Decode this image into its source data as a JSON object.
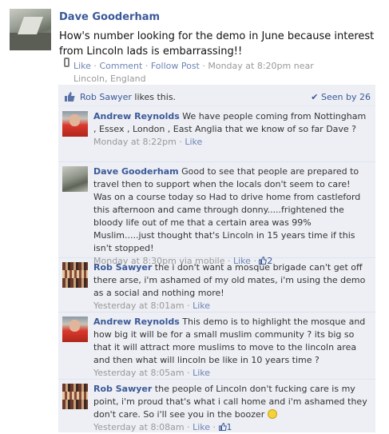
{
  "post": {
    "author": "Dave Gooderham",
    "text": "How's number looking for the demo in June because interest from Lincoln lads is embarrassing!!",
    "actions": {
      "like": "Like",
      "comment": "Comment",
      "follow": "Follow Post"
    },
    "time": "Monday at 8:20pm near Lincoln, England",
    "separator": " · "
  },
  "feedback": {
    "likes": {
      "name": "Rob Sawyer",
      "rest": " likes this."
    },
    "seen": "Seen by 26"
  },
  "comments": [
    {
      "author": "Andrew Reynolds",
      "text": "We have people coming from Nottingham , Essex , London , East Anglia that we know of so far Dave ?",
      "time": "Monday at 8:22pm",
      "like": "Like",
      "avatar": "andrew-avatar"
    },
    {
      "author": "Dave Gooderham",
      "text": "Good to see that people are prepared to travel then to support when the locals don't seem to care! Was on a course today so Had to drive home from castleford this afternoon and came through donny.....frightened the bloody life out of me that a certain area was 99% Muslim.....just thought that's Lincoln in 15 years time if this isn't stopped!",
      "time": "Monday at 8:30pm via mobile",
      "like": "Like",
      "like_count": "2",
      "avatar": "dave-avatar"
    },
    {
      "author": "Rob Sawyer",
      "text": "the i don't want a mosque brigade can't get off there arse, i'm ashamed of my old mates, i'm using the demo as a social and nothing more!",
      "time": "Yesterday at 8:01am",
      "like": "Like",
      "avatar": "rob-avatar"
    },
    {
      "author": "Andrew Reynolds",
      "text": "This demo is to highlight the mosque and how big it will be for a small muslim community ? its big so that it will attract more muslims to move to the lincoln area and then what will lincoln be like in 10 years time ?",
      "time": "Yesterday at 8:05am",
      "like": "Like",
      "avatar": "andrew-avatar"
    },
    {
      "author": "Rob Sawyer",
      "text": "the people of Lincoln don't fucking care is my point, i'm proud that's what i call home and i'm ashamed they don't care. So i'll see you in the boozer",
      "time": "Yesterday at 8:08am",
      "like": "Like",
      "like_count": "1",
      "avatar": "rob-avatar"
    }
  ]
}
